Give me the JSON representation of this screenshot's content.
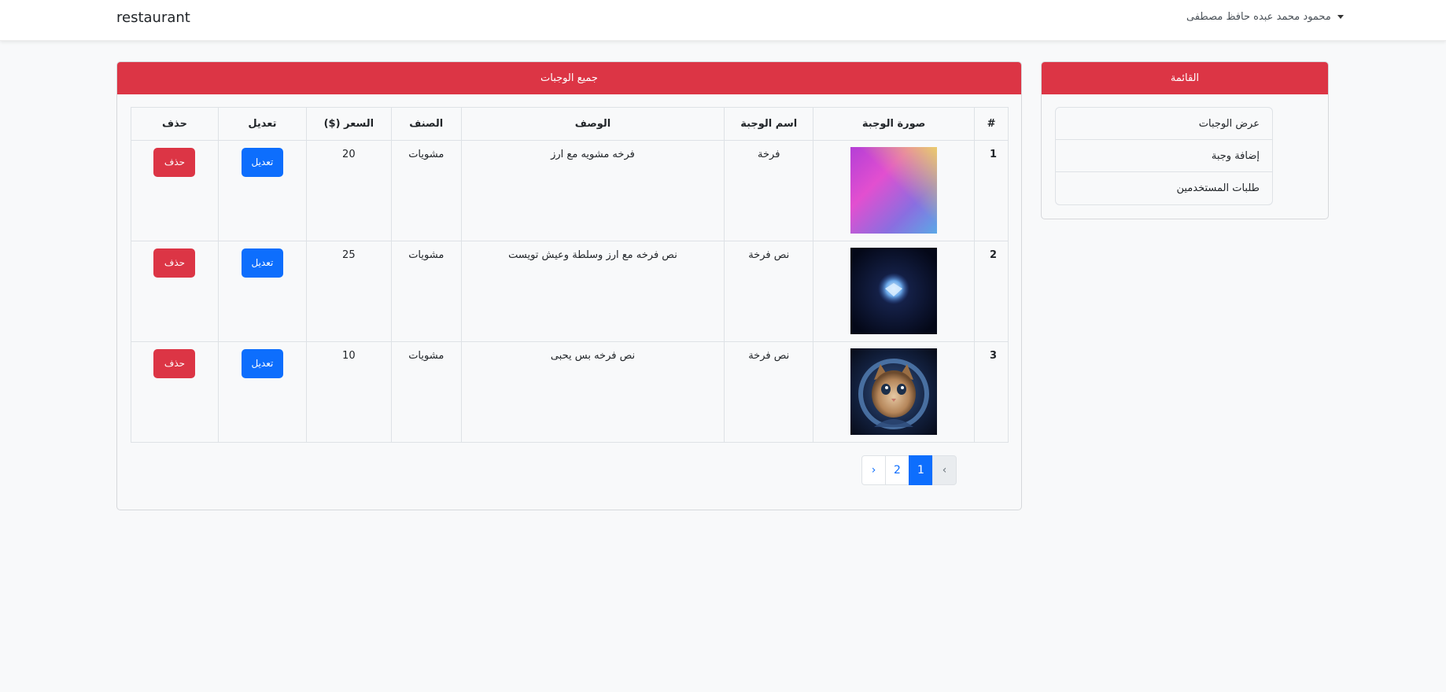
{
  "navbar": {
    "brand": "restaurant",
    "user_name": "محمود محمد عبده حافظ مصطفى"
  },
  "menu": {
    "title": "القائمة",
    "items": [
      {
        "label": "عرض الوجبات"
      },
      {
        "label": "إضافة وجبة"
      },
      {
        "label": "طلبات المستخدمين"
      }
    ]
  },
  "meals": {
    "title": "جميع الوجبات",
    "columns": {
      "num": "#",
      "image": "صورة الوجبة",
      "name": "اسم الوجبة",
      "description": "الوصف",
      "category": "الصنف",
      "price": "السعر ($)",
      "edit": "تعديل",
      "delete": "حذف"
    },
    "rows": [
      {
        "num": "1",
        "name": "فرخة",
        "description": "فرخه مشويه مع ارز",
        "category": "مشويات",
        "price": "20",
        "edit": "تعديل",
        "delete": "حذف"
      },
      {
        "num": "2",
        "name": "نص فرخة",
        "description": "نص فرخه مع ارز وسلطة وعيش تويست",
        "category": "مشويات",
        "price": "25",
        "edit": "تعديل",
        "delete": "حذف"
      },
      {
        "num": "3",
        "name": "نص فرخة",
        "description": "نص فرخه بس يحبى",
        "category": "مشويات",
        "price": "10",
        "edit": "تعديل",
        "delete": "حذف"
      }
    ]
  },
  "pagination": {
    "prev": "‹",
    "pages": [
      "2",
      "1"
    ],
    "next": "›"
  },
  "colors": {
    "header_red": "#dc3545",
    "primary_blue": "#0d6efd"
  }
}
